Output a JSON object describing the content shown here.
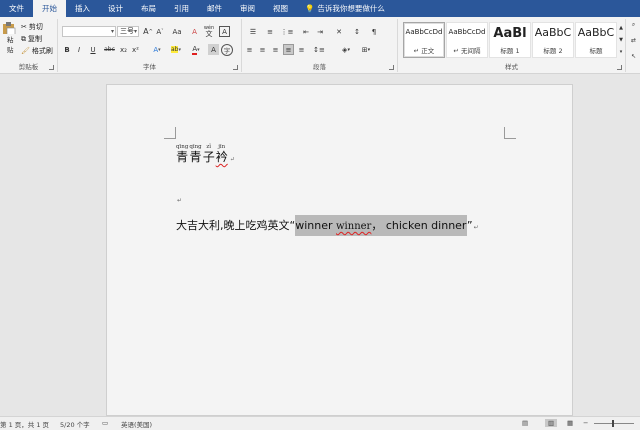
{
  "tabs": [
    "文件",
    "开始",
    "插入",
    "设计",
    "布局",
    "引用",
    "邮件",
    "审阅",
    "视图"
  ],
  "active_tab_index": 1,
  "tell_me": "告诉我你想要做什么",
  "clipboard": {
    "paste": "粘贴",
    "cut": "剪切",
    "copy": "复制",
    "format_painter": "格式刷",
    "label": "剪贴板"
  },
  "font": {
    "name": "",
    "size": "三号",
    "label": "字体",
    "grow": "A",
    "shrink": "A",
    "case": "Aa",
    "clear": "A",
    "wen": "wén",
    "border": "A",
    "bold": "B",
    "italic": "I",
    "underline": "U",
    "strike": "abc",
    "sub": "x₂",
    "sup": "x²",
    "effects": "A",
    "highlight": "ab",
    "color": "A",
    "shade": "A",
    "circle": "字"
  },
  "paragraph": {
    "label": "段落"
  },
  "styles": {
    "label": "样式",
    "items": [
      {
        "preview": "AaBbCcDd",
        "name": "↵ 正文"
      },
      {
        "preview": "AaBbCcDd",
        "name": "↵ 无间隔"
      },
      {
        "preview": "AaBl",
        "name": "标题 1"
      },
      {
        "preview": "AaBbC",
        "name": "标题 2"
      },
      {
        "preview": "AaBbC",
        "name": "标题"
      }
    ]
  },
  "doc": {
    "ruby": [
      {
        "py": "qīng",
        "hz": "青"
      },
      {
        "py": "qīng",
        "hz": "青"
      },
      {
        "py": "zǐ",
        "hz": "子"
      },
      {
        "py": "jīn",
        "hz": "衿"
      }
    ],
    "line2_plain": "大吉大利,晚上吃鸡英文“",
    "line2_w1": "winner ",
    "line2_w2": "winner",
    "line2_rest": "，  chicken dinner",
    "line2_close": "”",
    "para_mark": "↵"
  },
  "status": {
    "page": "第 1 页，共 1 页",
    "words": "5/20 个字",
    "lang": "英语(美国)"
  },
  "colors": {
    "ribbon": "#2b579a",
    "selection": "#b9b9b9"
  }
}
